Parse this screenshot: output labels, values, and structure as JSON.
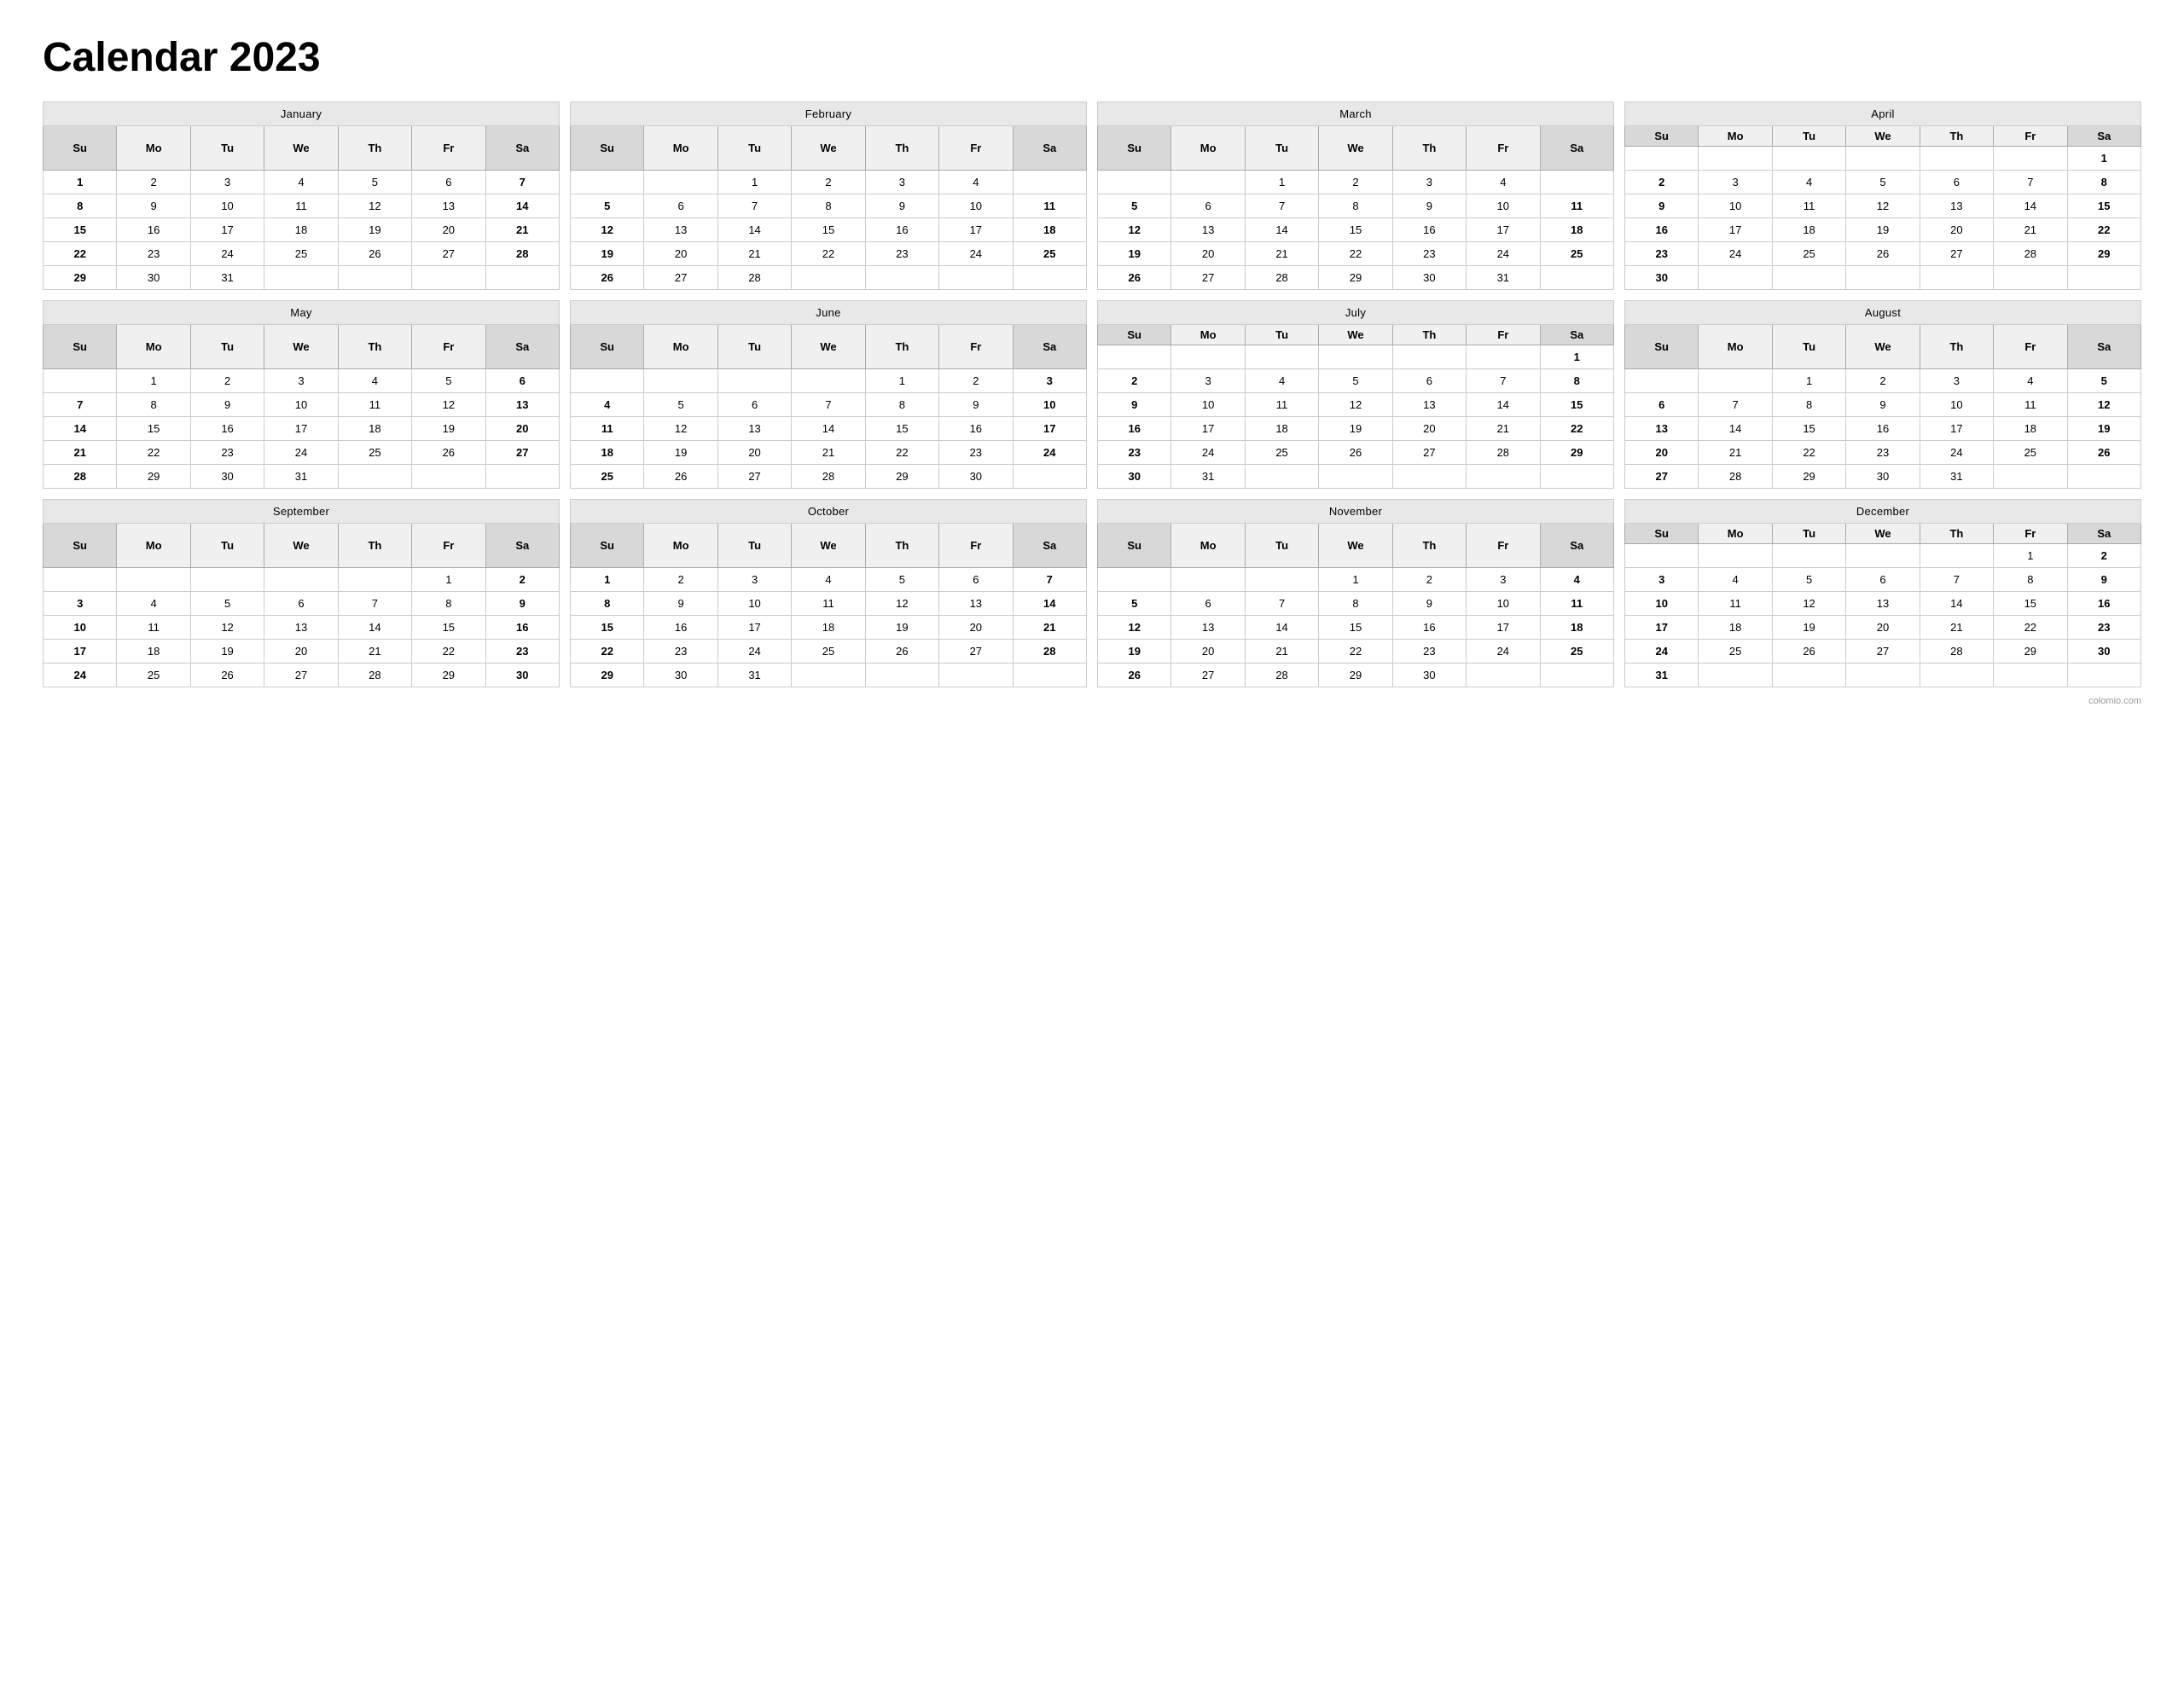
{
  "title": "Calendar 2023",
  "footer": "colomio.com",
  "months": [
    {
      "name": "January",
      "weeks": [
        [
          "1",
          "2",
          "3",
          "4",
          "5",
          "6",
          "7"
        ],
        [
          "8",
          "9",
          "10",
          "11",
          "12",
          "13",
          "14"
        ],
        [
          "15",
          "16",
          "17",
          "18",
          "19",
          "20",
          "21"
        ],
        [
          "22",
          "23",
          "24",
          "25",
          "26",
          "27",
          "28"
        ],
        [
          "29",
          "30",
          "31",
          "",
          "",
          "",
          ""
        ]
      ]
    },
    {
      "name": "February",
      "weeks": [
        [
          "",
          "",
          "1",
          "2",
          "3",
          "4",
          ""
        ],
        [
          "5",
          "6",
          "7",
          "8",
          "9",
          "10",
          "11"
        ],
        [
          "12",
          "13",
          "14",
          "15",
          "16",
          "17",
          "18"
        ],
        [
          "19",
          "20",
          "21",
          "22",
          "23",
          "24",
          "25"
        ],
        [
          "26",
          "27",
          "28",
          "",
          "",
          "",
          ""
        ]
      ]
    },
    {
      "name": "March",
      "weeks": [
        [
          "",
          "",
          "1",
          "2",
          "3",
          "4",
          ""
        ],
        [
          "5",
          "6",
          "7",
          "8",
          "9",
          "10",
          "11"
        ],
        [
          "12",
          "13",
          "14",
          "15",
          "16",
          "17",
          "18"
        ],
        [
          "19",
          "20",
          "21",
          "22",
          "23",
          "24",
          "25"
        ],
        [
          "26",
          "27",
          "28",
          "29",
          "30",
          "31",
          ""
        ]
      ]
    },
    {
      "name": "April",
      "weeks": [
        [
          "",
          "",
          "",
          "",
          "",
          "",
          "1"
        ],
        [
          "2",
          "3",
          "4",
          "5",
          "6",
          "7",
          "8"
        ],
        [
          "9",
          "10",
          "11",
          "12",
          "13",
          "14",
          "15"
        ],
        [
          "16",
          "17",
          "18",
          "19",
          "20",
          "21",
          "22"
        ],
        [
          "23",
          "24",
          "25",
          "26",
          "27",
          "28",
          "29"
        ],
        [
          "30",
          "",
          "",
          "",
          "",
          "",
          ""
        ]
      ]
    },
    {
      "name": "May",
      "weeks": [
        [
          "",
          "1",
          "2",
          "3",
          "4",
          "5",
          "6"
        ],
        [
          "7",
          "8",
          "9",
          "10",
          "11",
          "12",
          "13"
        ],
        [
          "14",
          "15",
          "16",
          "17",
          "18",
          "19",
          "20"
        ],
        [
          "21",
          "22",
          "23",
          "24",
          "25",
          "26",
          "27"
        ],
        [
          "28",
          "29",
          "30",
          "31",
          "",
          "",
          ""
        ]
      ]
    },
    {
      "name": "June",
      "weeks": [
        [
          "",
          "",
          "",
          "",
          "1",
          "2",
          "3"
        ],
        [
          "4",
          "5",
          "6",
          "7",
          "8",
          "9",
          "10"
        ],
        [
          "11",
          "12",
          "13",
          "14",
          "15",
          "16",
          "17"
        ],
        [
          "18",
          "19",
          "20",
          "21",
          "22",
          "23",
          "24"
        ],
        [
          "25",
          "26",
          "27",
          "28",
          "29",
          "30",
          ""
        ]
      ]
    },
    {
      "name": "July",
      "weeks": [
        [
          "",
          "",
          "",
          "",
          "",
          "",
          "1"
        ],
        [
          "2",
          "3",
          "4",
          "5",
          "6",
          "7",
          "8"
        ],
        [
          "9",
          "10",
          "11",
          "12",
          "13",
          "14",
          "15"
        ],
        [
          "16",
          "17",
          "18",
          "19",
          "20",
          "21",
          "22"
        ],
        [
          "23",
          "24",
          "25",
          "26",
          "27",
          "28",
          "29"
        ],
        [
          "30",
          "31",
          "",
          "",
          "",
          "",
          ""
        ]
      ]
    },
    {
      "name": "August",
      "weeks": [
        [
          "",
          "",
          "1",
          "2",
          "3",
          "4",
          "5"
        ],
        [
          "6",
          "7",
          "8",
          "9",
          "10",
          "11",
          "12"
        ],
        [
          "13",
          "14",
          "15",
          "16",
          "17",
          "18",
          "19"
        ],
        [
          "20",
          "21",
          "22",
          "23",
          "24",
          "25",
          "26"
        ],
        [
          "27",
          "28",
          "29",
          "30",
          "31",
          "",
          ""
        ]
      ]
    },
    {
      "name": "September",
      "weeks": [
        [
          "",
          "",
          "",
          "",
          "",
          "1",
          "2"
        ],
        [
          "3",
          "4",
          "5",
          "6",
          "7",
          "8",
          "9"
        ],
        [
          "10",
          "11",
          "12",
          "13",
          "14",
          "15",
          "16"
        ],
        [
          "17",
          "18",
          "19",
          "20",
          "21",
          "22",
          "23"
        ],
        [
          "24",
          "25",
          "26",
          "27",
          "28",
          "29",
          "30"
        ]
      ]
    },
    {
      "name": "October",
      "weeks": [
        [
          "1",
          "2",
          "3",
          "4",
          "5",
          "6",
          "7"
        ],
        [
          "8",
          "9",
          "10",
          "11",
          "12",
          "13",
          "14"
        ],
        [
          "15",
          "16",
          "17",
          "18",
          "19",
          "20",
          "21"
        ],
        [
          "22",
          "23",
          "24",
          "25",
          "26",
          "27",
          "28"
        ],
        [
          "29",
          "30",
          "31",
          "",
          "",
          "",
          ""
        ]
      ]
    },
    {
      "name": "November",
      "weeks": [
        [
          "",
          "",
          "",
          "1",
          "2",
          "3",
          "4"
        ],
        [
          "5",
          "6",
          "7",
          "8",
          "9",
          "10",
          "11"
        ],
        [
          "12",
          "13",
          "14",
          "15",
          "16",
          "17",
          "18"
        ],
        [
          "19",
          "20",
          "21",
          "22",
          "23",
          "24",
          "25"
        ],
        [
          "26",
          "27",
          "28",
          "29",
          "30",
          "",
          ""
        ]
      ]
    },
    {
      "name": "December",
      "weeks": [
        [
          "",
          "",
          "",
          "",
          "",
          "1",
          "2"
        ],
        [
          "3",
          "4",
          "5",
          "6",
          "7",
          "8",
          "9"
        ],
        [
          "10",
          "11",
          "12",
          "13",
          "14",
          "15",
          "16"
        ],
        [
          "17",
          "18",
          "19",
          "20",
          "21",
          "22",
          "23"
        ],
        [
          "24",
          "25",
          "26",
          "27",
          "28",
          "29",
          "30"
        ],
        [
          "31",
          "",
          "",
          "",
          "",
          "",
          ""
        ]
      ]
    }
  ],
  "dayHeaders": [
    "Su",
    "Mo",
    "Tu",
    "We",
    "Th",
    "Fr",
    "Sa"
  ]
}
